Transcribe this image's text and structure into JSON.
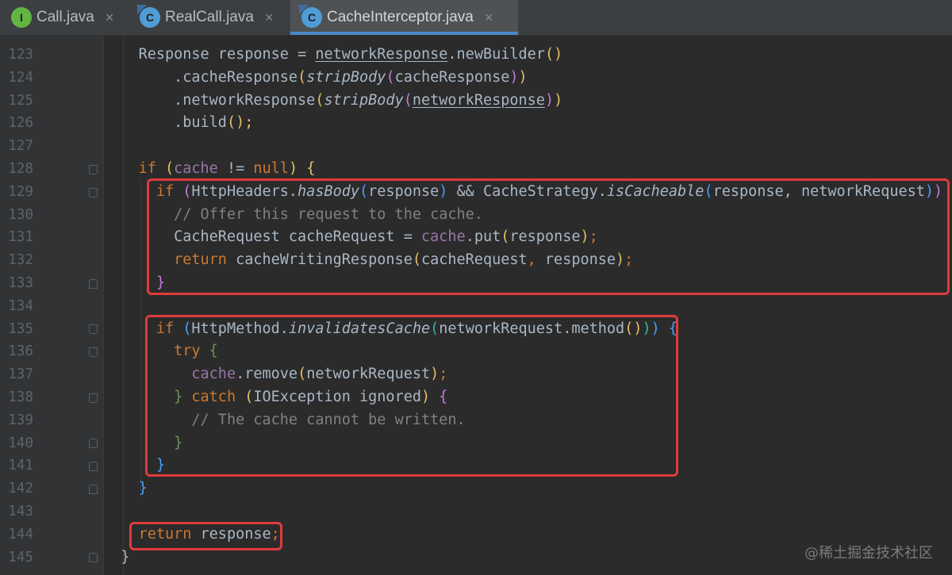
{
  "tabs": [
    {
      "label": "Call.java",
      "icon": "interface-icon",
      "icon_letter": "I",
      "close": "×",
      "active": false
    },
    {
      "label": "RealCall.java",
      "icon": "class-icon",
      "icon_letter": "C",
      "close": "×",
      "active": false
    },
    {
      "label": "CacheInterceptor.java",
      "icon": "class-icon",
      "icon_letter": "C",
      "close": "×",
      "active": true
    }
  ],
  "editor": {
    "line_numbers": [
      "123",
      "124",
      "125",
      "126",
      "127",
      "128",
      "129",
      "130",
      "131",
      "132",
      "133",
      "134",
      "135",
      "136",
      "137",
      "138",
      "139",
      "140",
      "141",
      "142",
      "143",
      "144",
      "145"
    ],
    "code": {
      "l123": {
        "indent": "    ",
        "t1": "Response response = ",
        "t2": "networkResponse",
        "t3": ".",
        "t4": "newBuilder",
        "t5": "()"
      },
      "l124": {
        "indent": "        ",
        "t1": ".",
        "t2": "cacheResponse",
        "t3": "(",
        "t4": "stripBody",
        "t5": "(",
        "t6": "cacheResponse",
        "t7": ")",
        "t8": ")"
      },
      "l125": {
        "indent": "        ",
        "t1": ".",
        "t2": "networkResponse",
        "t3": "(",
        "t4": "stripBody",
        "t5": "(",
        "t6": "networkResponse",
        "t7": ")",
        "t8": ")"
      },
      "l126": {
        "indent": "        ",
        "t1": ".",
        "t2": "build",
        "t3": "();"
      },
      "l128": {
        "indent": "    ",
        "t1": "if",
        "t2": " (",
        "t3": "cache",
        "t4": " != ",
        "t5": "null",
        "t6": ") {"
      },
      "l129": {
        "indent": "      ",
        "t1": "if",
        "t2": " (",
        "t3": "HttpHeaders.",
        "t4": "hasBody",
        "t5": "(",
        "t6": "response",
        "t7": ")",
        "t8": " && ",
        "t9": "CacheStrategy.",
        "t10": "isCacheable",
        "t11": "(",
        "t12": "response, networkRequest",
        "t13": ")",
        "t14": ")",
        "t15": " {"
      },
      "l130": {
        "indent": "        ",
        "t1": "// Offer this request to the cache."
      },
      "l131": {
        "indent": "        ",
        "t1": "CacheRequest cacheRequest = ",
        "t2": "cache",
        "t3": ".",
        "t4": "put",
        "t5": "(",
        "t6": "response",
        "t7": ")",
        "t8": ";"
      },
      "l132": {
        "indent": "        ",
        "t1": "return",
        "t2": " ",
        "t3": "cacheWritingResponse",
        "t4": "(",
        "t5": "cacheRequest",
        "t6": ",",
        "t7": " response",
        "t8": ")",
        "t9": ";"
      },
      "l133": {
        "indent": "      ",
        "t1": "}"
      },
      "l135": {
        "indent": "      ",
        "t1": "if",
        "t2": " (",
        "t3": "HttpMethod.",
        "t4": "invalidatesCache",
        "t5": "(",
        "t6": "networkRequest.",
        "t7": "method",
        "t8": "()",
        "t9": ")",
        "t10": ")",
        "t11": " {"
      },
      "l136": {
        "indent": "        ",
        "t1": "try",
        "t2": " {"
      },
      "l137": {
        "indent": "          ",
        "t1": "cache",
        "t2": ".",
        "t3": "remove",
        "t4": "(",
        "t5": "networkRequest",
        "t6": ")",
        "t7": ";"
      },
      "l138": {
        "indent": "        ",
        "t1": "}",
        "t2": " catch",
        "t3": " (",
        "t4": "IOException ignored",
        "t5": ")",
        "t6": " {"
      },
      "l139": {
        "indent": "          ",
        "t1": "// The cache cannot be written."
      },
      "l140": {
        "indent": "        ",
        "t1": "}"
      },
      "l141": {
        "indent": "      ",
        "t1": "}"
      },
      "l142": {
        "indent": "    ",
        "t1": "}"
      },
      "l144": {
        "indent": "    ",
        "t1": "return",
        "t2": " response",
        "t3": ";"
      },
      "l145": {
        "indent": "  ",
        "t1": "}"
      }
    }
  },
  "watermark": "@稀土掘金技术社区",
  "colors": {
    "keyword": "#cc7832",
    "field": "#9876aa",
    "comment": "#808080",
    "highlight_box": "#e03b3b",
    "active_tab_underline": "#4a88c7"
  }
}
